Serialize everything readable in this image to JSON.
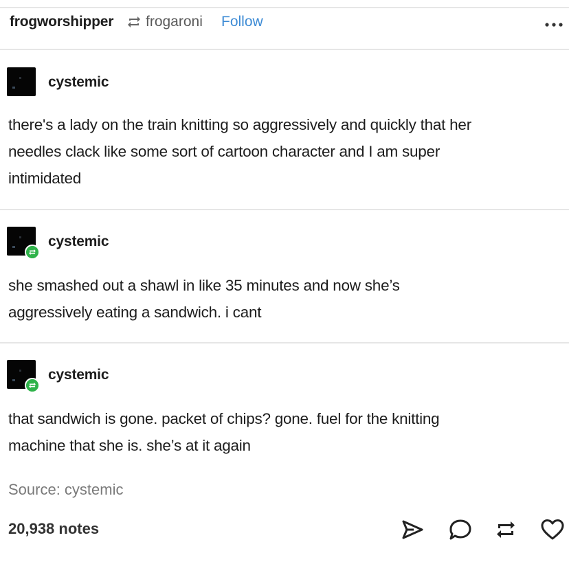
{
  "header": {
    "blog": "frogworshipper",
    "reblog_icon": "reblog-icon",
    "reblogged_from": "frogaroni",
    "follow_label": "Follow",
    "menu_icon": "more-options-icon"
  },
  "trail": [
    {
      "username": "cystemic",
      "avatar_icon": "avatar",
      "lines": [
        "there's a lady on the train knitting so aggressively and quickly that her",
        "needles clack like some sort of cartoon character and I am super",
        "intimidated"
      ]
    },
    {
      "username": "cystemic",
      "avatar_icon": "avatar-with-reblog-badge",
      "lines": [
        "she smashed out a shawl in like 35 minutes and now she’s",
        "aggressively eating a sandwich. i cant"
      ]
    },
    {
      "username": "cystemic",
      "avatar_icon": "avatar-with-reblog-badge",
      "lines": [
        "that sandwich is gone. packet of chips? gone. fuel for the knitting",
        "machine that she is. she’s at it again"
      ]
    }
  ],
  "footer": {
    "source": "Source: cystemic",
    "notes": "20,938 notes",
    "actions": [
      "share-icon",
      "reply-icon",
      "reblog-icon",
      "like-heart-icon"
    ]
  },
  "colors": {
    "follow": "#3d8bd5",
    "badge": "#2fb34a",
    "muted": "#7a7a7a"
  }
}
